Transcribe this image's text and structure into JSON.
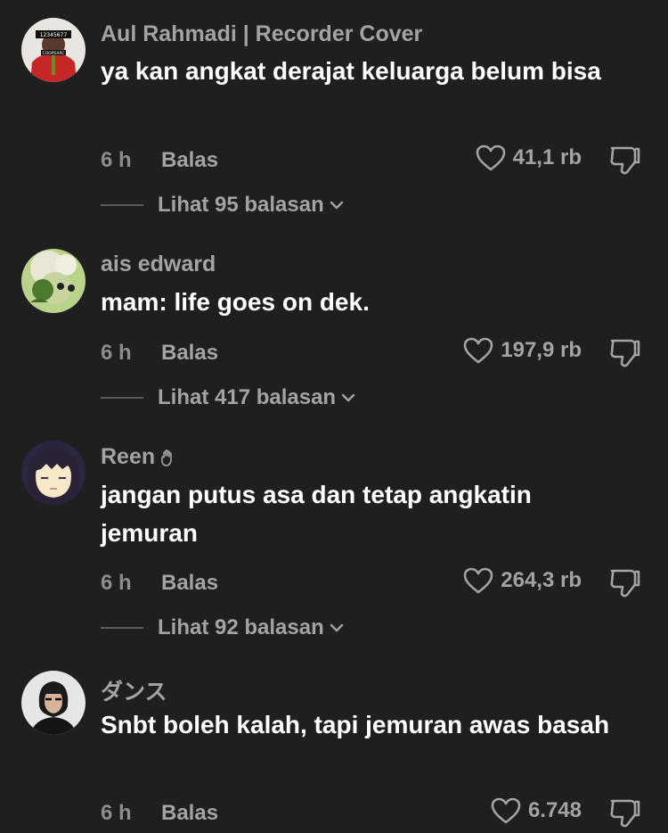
{
  "comments": [
    {
      "username": "Aul Rahmadi | Recorder Cover",
      "text": "ya kan angkat derajat keluarga belum bisa",
      "time": "6 h",
      "reply_label": "Balas",
      "likes": "41,1 rb",
      "replies_label": "Lihat 95 balasan",
      "avatar_caption_top": "12345677",
      "avatar_caption_bottom": "COOPSARC"
    },
    {
      "username": "ais edward",
      "text": "mam: life goes on dek.",
      "time": "6 h",
      "reply_label": "Balas",
      "likes": "197,9 rb",
      "replies_label": "Lihat 417 balasan"
    },
    {
      "username": "Reen",
      "text": "jangan putus asa dan tetap angkatin jemuran",
      "time": "6 h",
      "reply_label": "Balas",
      "likes": "264,3 rb",
      "replies_label": "Lihat 92 balasan"
    },
    {
      "username": "ダンス",
      "text": "Snbt boleh kalah, tapi jemuran awas basah",
      "time": "6 h",
      "reply_label": "Balas",
      "likes": "6.748"
    }
  ],
  "icons": {
    "like": "heart-outline-icon",
    "dislike": "thumbs-down-icon",
    "expand": "chevron-down-icon",
    "badge": "hand-badge-icon"
  },
  "colors": {
    "background": "#1f1f1f",
    "primary_text": "#ffffff",
    "secondary_text": "#a3a3a3"
  }
}
